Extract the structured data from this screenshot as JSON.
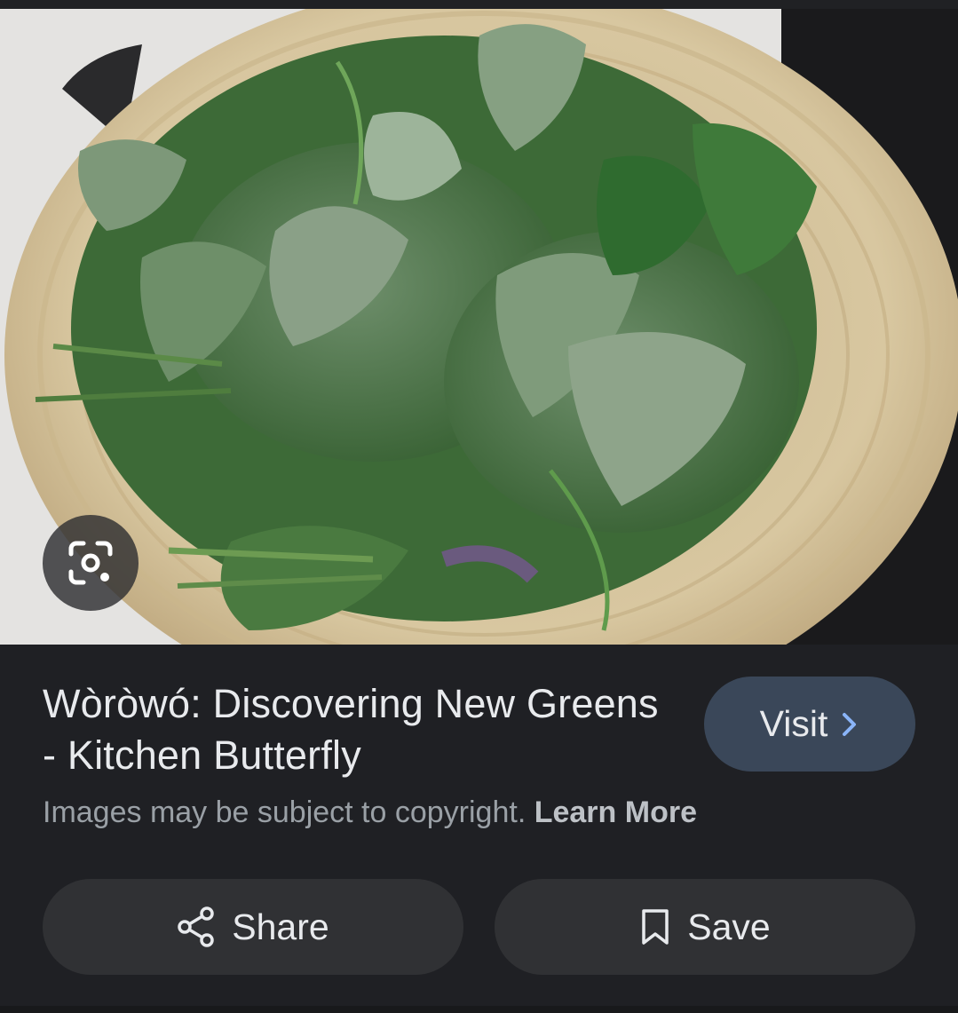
{
  "result": {
    "title": "Wòròwó: Discovering New Greens - Kitchen Butterfly",
    "visit_label": "Visit",
    "copyright_text": "Images may be subject to copyright.",
    "learn_more_label": "Learn More"
  },
  "actions": {
    "share_label": "Share",
    "save_label": "Save"
  },
  "icons": {
    "lens": "google-lens-icon",
    "visit": "chevron-right-icon",
    "share": "share-icon",
    "save": "bookmark-icon"
  },
  "colors": {
    "background": "#1f2024",
    "visit_button": "#3a4759",
    "action_button": "#303134",
    "accent_chevron": "#8ab4f8",
    "primary_text": "#e8eaed",
    "secondary_text": "#9aa0a6"
  }
}
